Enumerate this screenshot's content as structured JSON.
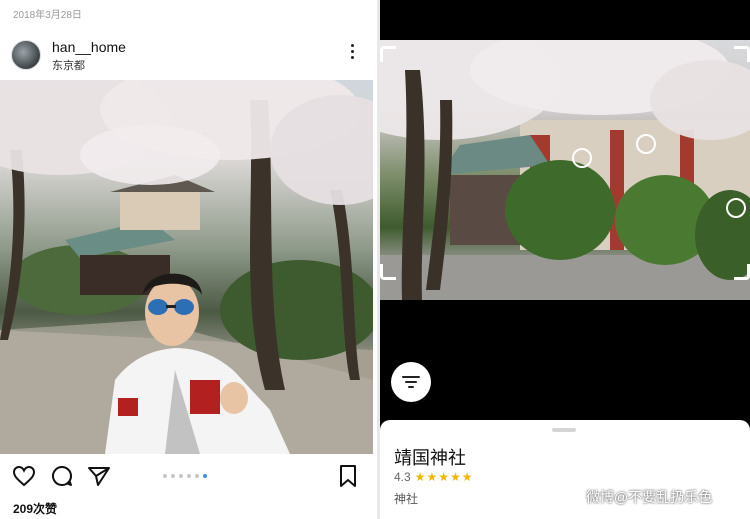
{
  "post": {
    "date": "2018年3月28日",
    "username": "han__home",
    "location": "东京都",
    "likes": "209次赞",
    "carousel_dots": 6,
    "active_dot": 5
  },
  "lens": {
    "place_name": "靖国神社",
    "rating": "4.3",
    "stars": "★★★★★",
    "category": "神社"
  },
  "watermark": "微博@不要乱扔乐色",
  "icons": {
    "more": "more-vertical-icon",
    "like": "heart-icon",
    "comment": "comment-icon",
    "share": "send-icon",
    "save": "bookmark-icon",
    "filter": "filter-icon"
  },
  "colors": {
    "active_dot": "#3a90e6",
    "star": "#f2b500"
  }
}
